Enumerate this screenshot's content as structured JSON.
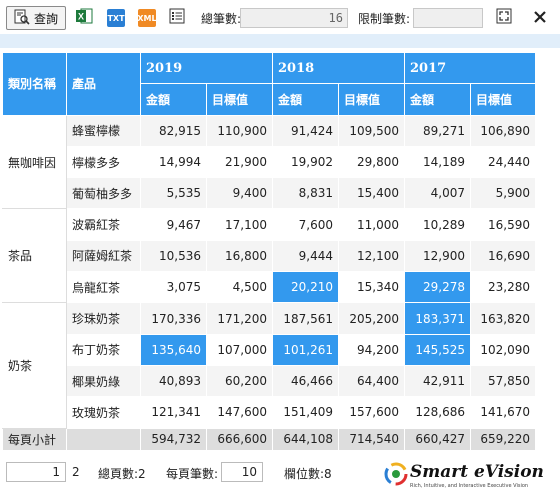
{
  "toolbar": {
    "query_label": "查詢",
    "excel_icon": "excel-icon",
    "txt_label": "TXT",
    "xml_label": "XML",
    "total_label": "總筆數:",
    "total_value": "16",
    "limit_label": "限制筆數:",
    "limit_value": ""
  },
  "table": {
    "headers": {
      "category": "類別名稱",
      "product": "產品",
      "years": [
        "2019",
        "2018",
        "2017"
      ],
      "amount": "金額",
      "target": "目標值"
    },
    "categories": [
      "無咖啡因",
      "茶品",
      "奶茶"
    ],
    "rows": [
      {
        "product": "蜂蜜檸檬",
        "v": [
          "82,915",
          "110,900",
          "91,424",
          "109,500",
          "89,271",
          "106,890"
        ]
      },
      {
        "product": "檸檬多多",
        "v": [
          "14,994",
          "21,900",
          "19,902",
          "29,800",
          "14,189",
          "24,440"
        ]
      },
      {
        "product": "葡萄柚多多",
        "v": [
          "5,535",
          "9,400",
          "8,831",
          "15,400",
          "4,007",
          "5,900"
        ]
      },
      {
        "product": "波霸紅茶",
        "v": [
          "9,467",
          "17,100",
          "7,600",
          "11,000",
          "10,289",
          "16,590"
        ]
      },
      {
        "product": "阿薩姆紅茶",
        "v": [
          "10,536",
          "16,800",
          "9,444",
          "12,100",
          "12,900",
          "16,690"
        ]
      },
      {
        "product": "烏龍紅茶",
        "v": [
          "3,075",
          "4,500",
          "20,210",
          "15,340",
          "29,278",
          "23,280"
        ]
      },
      {
        "product": "珍珠奶茶",
        "v": [
          "170,336",
          "171,200",
          "187,561",
          "205,200",
          "183,371",
          "163,820"
        ]
      },
      {
        "product": "布丁奶茶",
        "v": [
          "135,640",
          "107,000",
          "101,261",
          "94,200",
          "145,525",
          "102,090"
        ]
      },
      {
        "product": "椰果奶綠",
        "v": [
          "40,893",
          "60,200",
          "46,466",
          "64,400",
          "42,911",
          "57,850"
        ]
      },
      {
        "product": "玫瑰奶茶",
        "v": [
          "121,341",
          "147,600",
          "151,409",
          "157,600",
          "128,686",
          "141,670"
        ]
      }
    ],
    "subtotal": {
      "label": "每頁小計",
      "v": [
        "594,732",
        "666,600",
        "644,108",
        "714,540",
        "660,427",
        "659,220"
      ]
    }
  },
  "pager": {
    "page_input": "1",
    "total_pages_num": "2",
    "total_pages_label": "總頁數:2",
    "page_size_label": "每頁筆數:",
    "page_size_value": "10",
    "field_count_label": "欄位數:8"
  },
  "logo": {
    "brand": "Smart eVision",
    "tagline": "Rich, Intuitive, and Interactive Executive Vision"
  },
  "colors": {
    "header_blue": "#3399ee",
    "highlight_blue": "#3399ee",
    "band": "#e1eefa"
  }
}
